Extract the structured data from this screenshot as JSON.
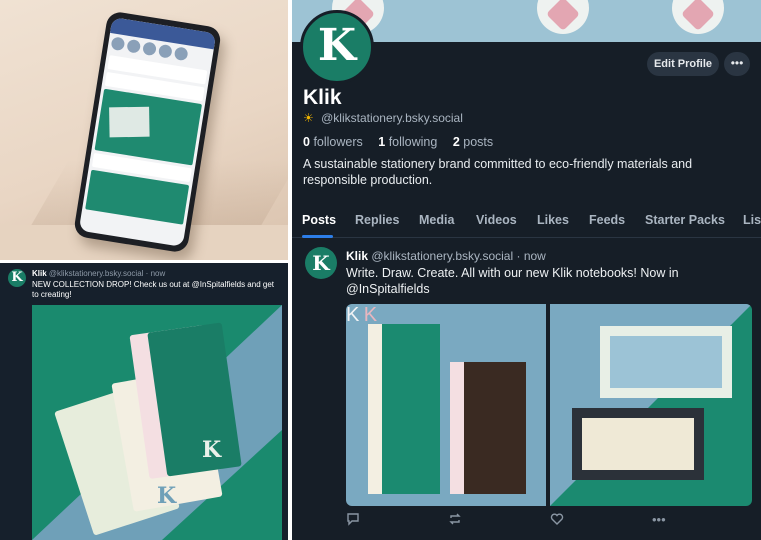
{
  "left_post": {
    "name": "Klik",
    "handle": "@klikstationery.bsky.social",
    "time": "now",
    "text": "NEW COLLECTION DROP! Check us out at @InSpitalfields and get to creating!"
  },
  "profile": {
    "name": "Klik",
    "handle": "@klikstationery.bsky.social",
    "edit_label": "Edit Profile",
    "more_label": "•••",
    "followers_count": "0",
    "followers_label": "followers",
    "following_count": "1",
    "following_label": "following",
    "posts_count": "2",
    "posts_label": "posts",
    "bio": "A sustainable stationery brand committed to eco-friendly materials and responsible production."
  },
  "tabs": [
    "Posts",
    "Replies",
    "Media",
    "Videos",
    "Likes",
    "Feeds",
    "Starter Packs",
    "Lists"
  ],
  "feed_post": {
    "name": "Klik",
    "handle": "@klikstationery.bsky.social",
    "time": "now",
    "text": "Write. Draw. Create. All with our new Klik notebooks! Now in @InSpitalfields",
    "image_logo": "Klik"
  },
  "avatar_letter": "K",
  "icons": {
    "sun": "sun-icon",
    "reply": "reply-icon",
    "repost": "repost-icon",
    "like": "heart-icon",
    "more": "more-icon"
  },
  "colors": {
    "brand_green": "#1a7d66",
    "background": "#161e27",
    "accent": "#2d7ee8"
  }
}
